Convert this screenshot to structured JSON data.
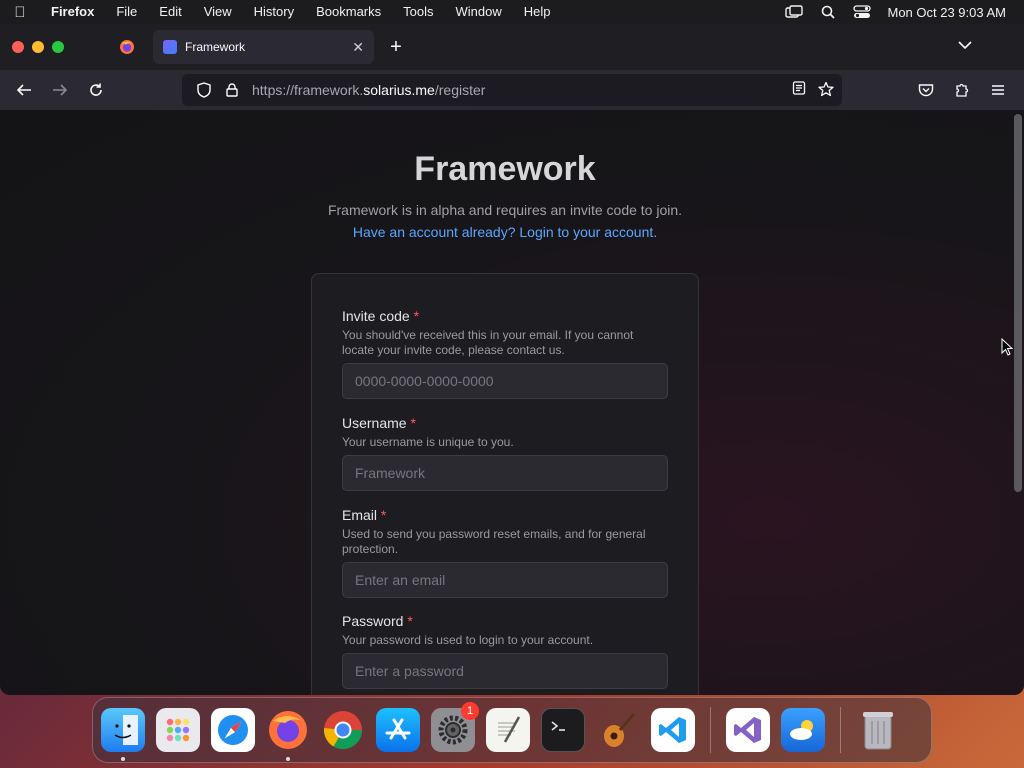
{
  "menubar": {
    "app_name": "Firefox",
    "items": [
      "File",
      "Edit",
      "View",
      "History",
      "Bookmarks",
      "Tools",
      "Window",
      "Help"
    ],
    "clock": "Mon Oct 23  9:03 AM"
  },
  "browser": {
    "tab_title": "Framework",
    "url_prefix": "https://framework.",
    "url_host": "solarius.me",
    "url_path": "/register"
  },
  "page": {
    "title": "Framework",
    "subtitle": "Framework is in alpha and requires an invite code to join.",
    "login_link": "Have an account already? Login to your account.",
    "fields": [
      {
        "label": "Invite code",
        "required": "*",
        "help": "You should've received this in your email. If you cannot locate your invite code, please contact us.",
        "placeholder": "0000-0000-0000-0000"
      },
      {
        "label": "Username",
        "required": "*",
        "help": "Your username is unique to you.",
        "placeholder": "Framework"
      },
      {
        "label": "Email",
        "required": "*",
        "help": "Used to send you password reset emails, and for general protection.",
        "placeholder": "Enter an email"
      },
      {
        "label": "Password",
        "required": "*",
        "help": "Your password is used to login to your account.",
        "placeholder": "Enter a password"
      }
    ]
  },
  "dock": {
    "apps": [
      "finder",
      "launchpad",
      "safari",
      "firefox",
      "chrome",
      "app-store",
      "system-settings",
      "textedit",
      "terminal",
      "garageband",
      "vscode",
      "visual-studio",
      "weather",
      "trash"
    ],
    "settings_badge": "1"
  },
  "colors": {
    "accent_link": "#5aa7ff",
    "required": "#ff5a5a",
    "card_bg": "#1d1c20"
  }
}
